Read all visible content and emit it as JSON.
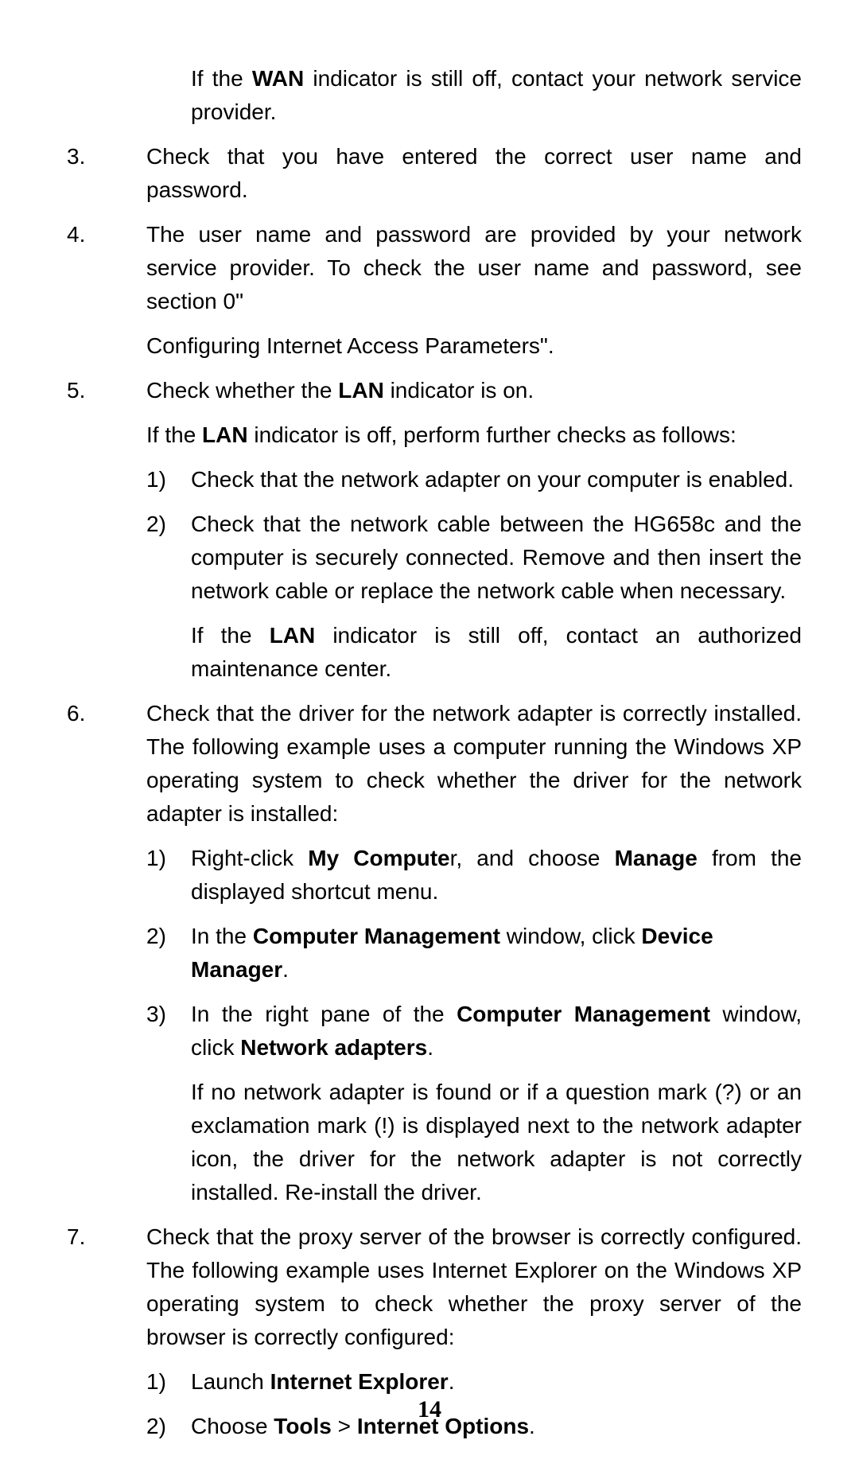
{
  "page_number": "14",
  "lead_prefix": "If the ",
  "lead_bold": "WAN",
  "lead_suffix": " indicator is still off, contact your network service provider.",
  "items": [
    {
      "num": "3.",
      "p1": "Check that you have entered the correct user name and password."
    },
    {
      "num": "4.",
      "p1": "The user name and password are provided by your network service provider. To check the user name and password, see section 0\"",
      "p2": "Configuring Internet Access Parameters\"."
    },
    {
      "num": "5.",
      "p1_pre": "Check whether the ",
      "p1_b": "LAN",
      "p1_post": " indicator is on.",
      "p2_pre": "If the ",
      "p2_b": "LAN",
      "p2_post": " indicator is off, perform further checks as follows:",
      "sub": [
        {
          "num": "1)",
          "t": "Check that the network adapter on your computer is enabled."
        },
        {
          "num": "2)",
          "t": "Check that the network cable between the HG658c and the computer is securely connected. Remove and then insert the network cable or replace the network cable when necessary.",
          "after_pre": "If the ",
          "after_b": "LAN",
          "after_post": " indicator is still off, contact an authorized maintenance center."
        }
      ]
    },
    {
      "num": "6.",
      "p1": "Check that the driver for the network adapter is correctly installed. The following example uses a computer running the Windows XP operating system to check whether the driver for the network adapter is installed:",
      "sub": [
        {
          "num": "1)",
          "t_pre": "Right-click ",
          "t_b1": "My Compute",
          "t_mid": "r, and choose ",
          "t_b2": "Manage",
          "t_post": " from the displayed shortcut menu."
        },
        {
          "num": "2)",
          "t_pre": "In the ",
          "t_b1": "Computer Management",
          "t_mid": " window, click ",
          "t_b2": "Device Manager",
          "t_post": "."
        },
        {
          "num": "3)",
          "t_pre": "In the right pane of the ",
          "t_b1": "Computer Management",
          "t_mid": " window, click ",
          "t_b2": "Network adapters",
          "t_post": ".",
          "after": "If no network adapter is found or if a question mark (?) or an exclamation mark (!) is displayed next to the network adapter icon, the driver for the network adapter is not correctly installed. Re-install the driver."
        }
      ]
    },
    {
      "num": "7.",
      "p1": "Check that the proxy server of the browser is correctly configured. The following example uses Internet Explorer on the Windows XP operating system to check whether the proxy server of the browser is correctly configured:",
      "sub": [
        {
          "num": "1)",
          "t_pre": "Launch ",
          "t_b1": "Internet Explorer",
          "t_post": "."
        },
        {
          "num": "2)",
          "t_pre": "Choose ",
          "t_b1": "Tools",
          "t_mid": " > ",
          "t_b2": "Internet Options",
          "t_post": "."
        }
      ]
    }
  ]
}
